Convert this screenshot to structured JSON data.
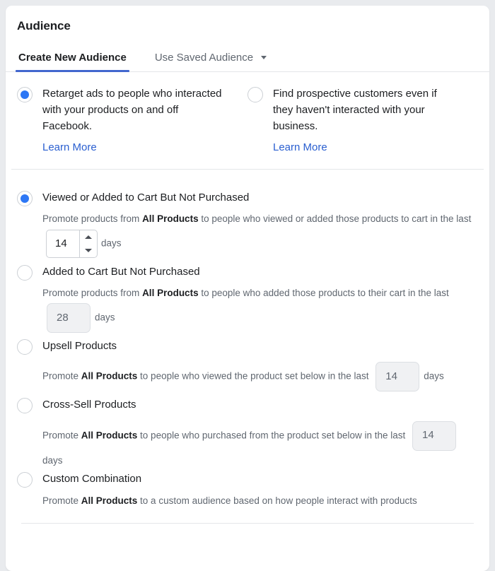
{
  "card": {
    "title": "Audience"
  },
  "tabs": [
    {
      "label": "Create New Audience",
      "active": true,
      "caret": false
    },
    {
      "label": "Use Saved Audience",
      "active": false,
      "caret": true
    }
  ],
  "audience_type": {
    "learn_more_label": "Learn More",
    "options": [
      {
        "text": "Retarget ads to people who interacted with your products on and off Facebook.",
        "selected": true
      },
      {
        "text": "Find prospective customers even if they haven't interacted with your business.",
        "selected": false
      }
    ]
  },
  "retarget_options": [
    {
      "id": "viewed-or-added-to-cart-but-not-purchased",
      "title": "Viewed or Added to Cart But Not Purchased",
      "selected": true,
      "desc_before": "Promote products from ",
      "desc_bold": "All Products",
      "desc_mid": " to people who viewed or added those products to cart in the last ",
      "days_value": "14",
      "days_label": "days",
      "stepper_enabled": true
    },
    {
      "id": "added-to-cart-but-not-purchased",
      "title": "Added to Cart But Not Purchased",
      "selected": false,
      "desc_before": "Promote products from ",
      "desc_bold": "All Products",
      "desc_mid": " to people who added those products to their cart in the last ",
      "days_value": "28",
      "days_label": "days",
      "stepper_enabled": false
    },
    {
      "id": "upsell-products",
      "title": "Upsell Products",
      "selected": false,
      "desc_before": "Promote ",
      "desc_bold": "All Products",
      "desc_mid": " to people who viewed the product set below in the last ",
      "days_value": "14",
      "days_label": "days",
      "stepper_enabled": false
    },
    {
      "id": "cross-sell-products",
      "title": "Cross-Sell Products",
      "selected": false,
      "desc_before": "Promote ",
      "desc_bold": "All Products",
      "desc_mid": " to people who purchased from the product set below in the last ",
      "days_value": "14",
      "days_label": "days",
      "stepper_enabled": false
    },
    {
      "id": "custom-combination",
      "title": "Custom Combination",
      "selected": false,
      "desc_before": "Promote ",
      "desc_bold": "All Products",
      "desc_mid": " to a custom audience based on how people interact with products",
      "days_value": "",
      "days_label": "",
      "stepper_enabled": false
    }
  ],
  "colors": {
    "accent_blue": "#2d77f5",
    "tab_underline": "#4267ce",
    "link_blue": "#2a5fd0",
    "text_primary": "#1c1e21",
    "text_secondary": "#606770"
  }
}
